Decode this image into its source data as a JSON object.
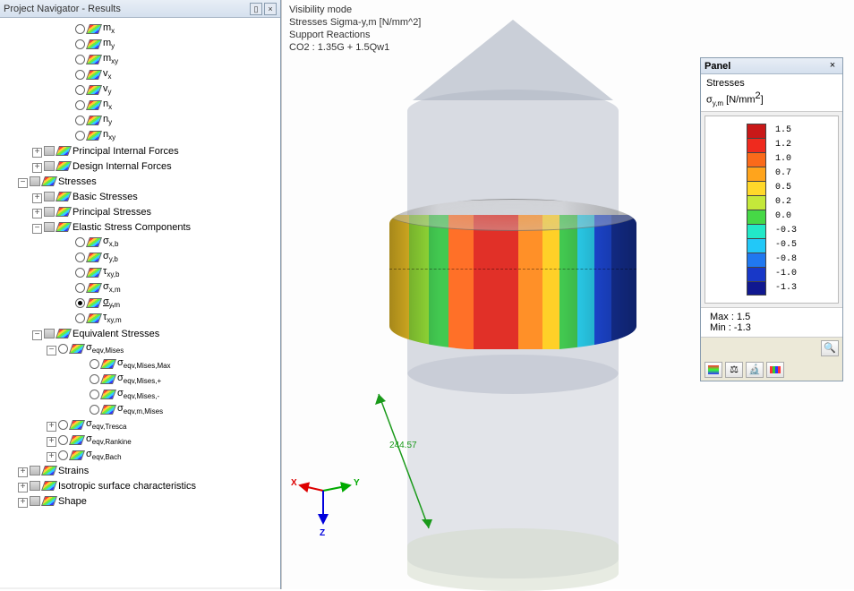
{
  "navigator": {
    "title": "Project Navigator - Results",
    "tree": {
      "forces": [
        {
          "label": "m<sub>x</sub>"
        },
        {
          "label": "m<sub>y</sub>"
        },
        {
          "label": "m<sub>xy</sub>"
        },
        {
          "label": "v<sub>x</sub>"
        },
        {
          "label": "v<sub>y</sub>"
        },
        {
          "label": "n<sub>x</sub>"
        },
        {
          "label": "n<sub>y</sub>"
        },
        {
          "label": "n<sub>xy</sub>"
        }
      ],
      "principal_if": "Principal Internal Forces",
      "design_if": "Design Internal Forces",
      "stresses": "Stresses",
      "basic_stresses": "Basic Stresses",
      "principal_stresses": "Principal Stresses",
      "elastic": "Elastic Stress Components",
      "elastic_items": [
        {
          "label": "σ<sub>x,b</sub>"
        },
        {
          "label": "σ<sub>y,b</sub>"
        },
        {
          "label": "τ<sub>xy,b</sub>"
        },
        {
          "label": "σ<sub>x,m</sub>"
        },
        {
          "label": "σ<sub>y,m</sub>",
          "selected": true
        },
        {
          "label": "τ<sub>xy,m</sub>"
        }
      ],
      "equivalent": "Equivalent Stresses",
      "mises": "σ<sub>eqv,Mises</sub>",
      "mises_items": [
        {
          "label": "σ<sub>eqv,Mises,Max</sub>"
        },
        {
          "label": "σ<sub>eqv,Mises,+</sub>"
        },
        {
          "label": "σ<sub>eqv,Mises,-</sub>"
        },
        {
          "label": "σ<sub>eqv,m,Mises</sub>"
        }
      ],
      "tresca": "σ<sub>eqv,Tresca</sub>",
      "rankine": "σ<sub>eqv,Rankine</sub>",
      "bach": "σ<sub>eqv,Bach</sub>",
      "strains": "Strains",
      "iso": "Isotropic surface characteristics",
      "shape": "Shape"
    }
  },
  "overlay": {
    "line1": "Visibility mode",
    "line2": "Stresses Sigma-y,m [N/mm^2]",
    "line3": "Support Reactions",
    "line4": "CO2 : 1.35G + 1.5Qw1"
  },
  "triad": {
    "x": "X",
    "y": "Y",
    "z": "Z"
  },
  "dimension": "244.57",
  "panel": {
    "title": "Panel",
    "stresses": "Stresses",
    "unit_label": "σ<sub>y,m</sub> [N/mm<sup>2</sup>]",
    "legend": [
      {
        "color": "#c91818",
        "val": " 1.5"
      },
      {
        "color": "#ef2a1e",
        "val": " 1.2"
      },
      {
        "color": "#fa6a1a",
        "val": " 1.0"
      },
      {
        "color": "#ffa41c",
        "val": " 0.7"
      },
      {
        "color": "#ffd82a",
        "val": " 0.5"
      },
      {
        "color": "#c4e83a",
        "val": " 0.2"
      },
      {
        "color": "#46d846",
        "val": " 0.0"
      },
      {
        "color": "#22e8c8",
        "val": "-0.3"
      },
      {
        "color": "#22c8f8",
        "val": "-0.5"
      },
      {
        "color": "#2078f0",
        "val": "-0.8"
      },
      {
        "color": "#1838c8",
        "val": "-1.0"
      },
      {
        "color": "#101890",
        "val": "-1.3"
      }
    ],
    "max": "Max :  1.5",
    "min": "Min : -1.3"
  }
}
